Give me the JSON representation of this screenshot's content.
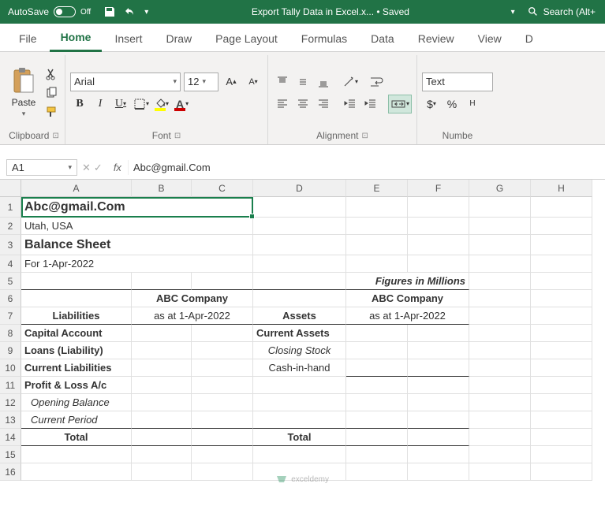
{
  "titlebar": {
    "autosave": "AutoSave",
    "toggle_state": "Off",
    "document": "Export Tally Data in Excel.x... • Saved",
    "search": "Search (Alt+"
  },
  "tabs": [
    "File",
    "Home",
    "Insert",
    "Draw",
    "Page Layout",
    "Formulas",
    "Data",
    "Review",
    "View",
    "D"
  ],
  "active_tab": "Home",
  "ribbon": {
    "groups": {
      "clipboard": "Clipboard",
      "font": "Font",
      "alignment": "Alignment",
      "number": "Numbe"
    },
    "paste": "Paste",
    "font_name": "Arial",
    "font_size": "12",
    "number_format": "Text"
  },
  "formula_bar": {
    "name": "A1",
    "value": "Abc@gmail.Com"
  },
  "columns": [
    "A",
    "B",
    "C",
    "D",
    "E",
    "F",
    "G",
    "H"
  ],
  "sheet": {
    "a1": "Abc@gmail.Com",
    "a2": "Utah, USA",
    "a3": "Balance Sheet",
    "a4": "For 1-Apr-2022",
    "e5": "Figures in Millions",
    "b6": "ABC Company",
    "e6": "ABC Company",
    "a7": "Liabilities",
    "b7": "as at 1-Apr-2022",
    "d7": "Assets",
    "e7": "as at 1-Apr-2022",
    "a8": "Capital Account",
    "d8": "Current Assets",
    "a9": "Loans (Liability)",
    "d9": "Closing Stock",
    "a10": "Current Liabilities",
    "d10": "Cash-in-hand",
    "a11": "Profit & Loss A/c",
    "a12": "Opening Balance",
    "a13": "Current Period",
    "a14": "Total",
    "d14": "Total"
  },
  "watermark": "exceldemy"
}
